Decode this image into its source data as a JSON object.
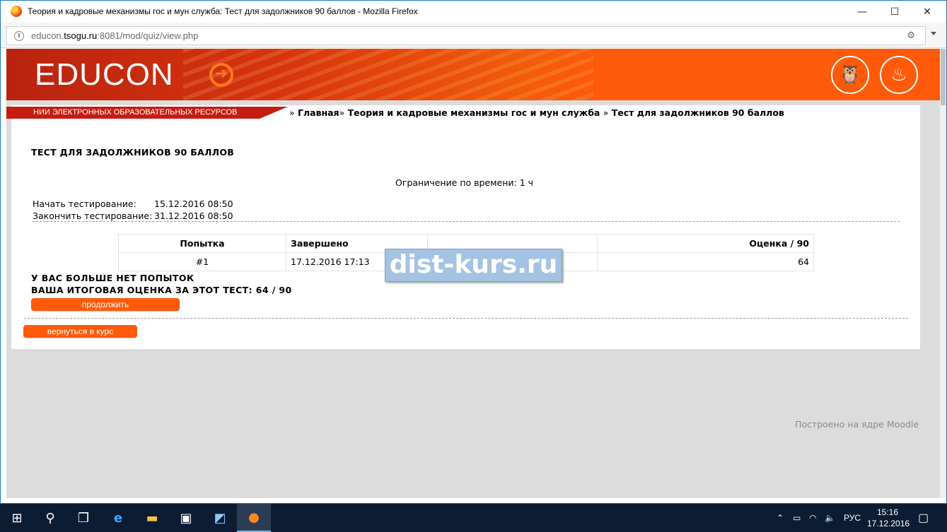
{
  "window": {
    "title": "Теория и кадровые механизмы гос и мун служба: Тест для задолжников 90 баллов - Mozilla Firefox",
    "minimize": "—",
    "maximize": "☐",
    "close": "✕"
  },
  "address_bar": {
    "url_prefix": "educon.",
    "url_host": "tsogu.ru",
    "url_rest": ":8081/mod/quiz/view.php"
  },
  "banner": {
    "logo_text": "EDUCON",
    "nii_label": "НИИ ЭЛЕКТРОННЫХ ОБРАЗОВАТЕЛЬНЫХ РЕСУРСОВ"
  },
  "breadcrumb": {
    "sep": "»",
    "items": [
      "Главная",
      "Теория и кадровые механизмы гос и мун служба",
      "Тест для задолжников 90 баллов"
    ]
  },
  "quiz": {
    "heading": "ТЕСТ ДЛЯ ЗАДОЛЖНИКОВ 90 БАЛЛОВ",
    "time_limit": "Ограничение по времени: 1 ч",
    "start_label": "Начать тестирование:",
    "start_value": "15.12.2016 08:50",
    "end_label": "Закончить тестирование:",
    "end_value": "31.12.2016 08:50",
    "table": {
      "headers": [
        "Попытка",
        "Завершено",
        "",
        "Оценка / 90"
      ],
      "rows": [
        [
          "#1",
          "17.12.2016 17:13",
          "",
          "64"
        ]
      ]
    },
    "no_more_attempts": "У ВАС БОЛЬШЕ НЕТ ПОПЫТОК",
    "final_grade": "ВАША ИТОГОВАЯ ОЦЕНКА ЗА ЭТОТ ТЕСТ: 64 / 90",
    "continue_button": "продолжить",
    "back_button": "вернуться в курс"
  },
  "watermark": "dist-kurs.ru",
  "footer": "Построено на ядре Moodle",
  "taskbar": {
    "language": "РУС",
    "time": "15:16",
    "date": "17.12.2016"
  }
}
